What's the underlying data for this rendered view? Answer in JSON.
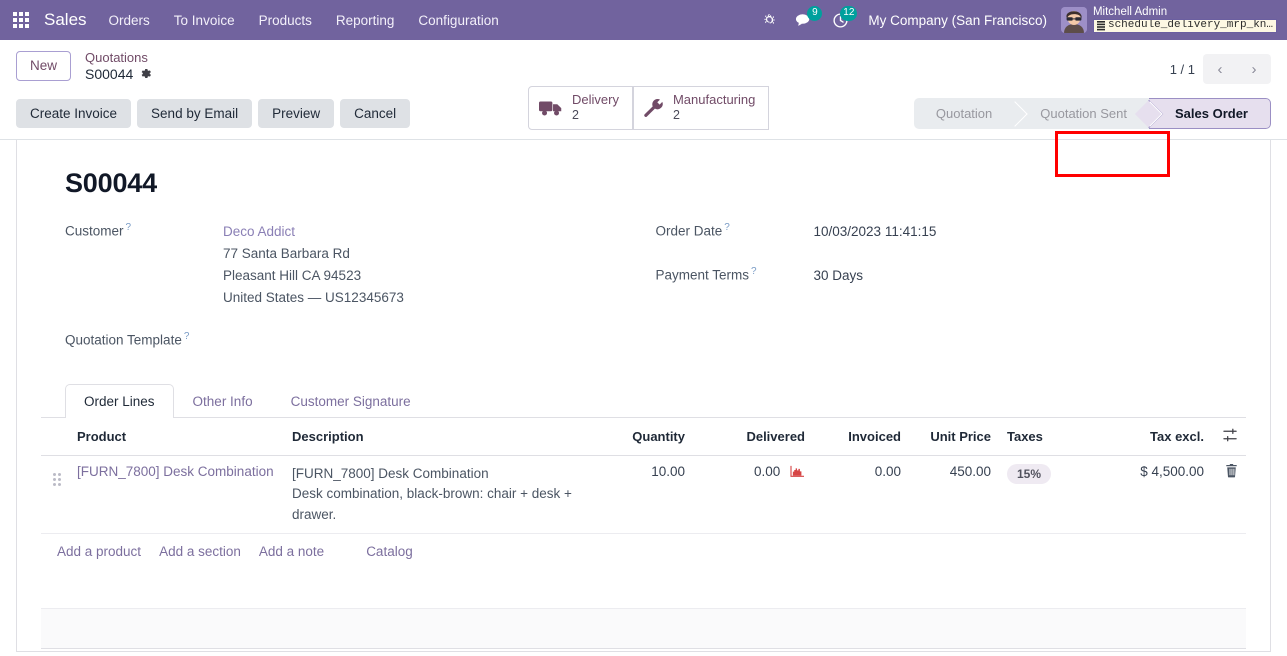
{
  "navbar": {
    "apps_icon": "apps-grid-icon",
    "brand": "Sales",
    "menu": [
      "Orders",
      "To Invoice",
      "Products",
      "Reporting",
      "Configuration"
    ],
    "systray": [
      {
        "icon": "bug-icon",
        "badge": ""
      },
      {
        "icon": "chat-bubble-icon",
        "badge": "9"
      },
      {
        "icon": "activity-clock-icon",
        "badge": "12"
      }
    ],
    "company": "My Company (San Francisco)",
    "user_name": "Mitchell Admin",
    "branch_chip": "schedule_delivery_mrp_kn…",
    "branch_icon": "database-icon"
  },
  "control_panel": {
    "new_button": "New",
    "breadcrumb_parent": "Quotations",
    "breadcrumb_current": "S00044",
    "gear_icon": "gear-icon",
    "smart_buttons": [
      {
        "icon": "truck-icon",
        "label": "Delivery",
        "value": "2",
        "highlighted": true
      },
      {
        "icon": "wrench-icon",
        "label": "Manufacturing",
        "value": "2",
        "highlighted": false
      }
    ],
    "pager_text": "1 / 1",
    "pager_prev_icon": "chevron-left-icon",
    "pager_next_icon": "chevron-right-icon",
    "action_buttons": [
      "Create Invoice",
      "Send by Email",
      "Preview",
      "Cancel"
    ],
    "status_steps": [
      {
        "label": "Quotation",
        "active": false
      },
      {
        "label": "Quotation Sent",
        "active": false
      },
      {
        "label": "Sales Order",
        "active": true
      }
    ]
  },
  "form": {
    "record_title": "S00044",
    "left_fields": [
      {
        "label": "Customer",
        "help": "?",
        "link_value": "Deco Addict",
        "address": [
          "77 Santa Barbara Rd",
          "Pleasant Hill CA 94523",
          "United States — US12345673"
        ]
      },
      {
        "label": "Quotation Template",
        "help": "?",
        "value": ""
      }
    ],
    "right_fields": [
      {
        "label": "Order Date",
        "help": "?",
        "value": "10/03/2023 11:41:15"
      },
      {
        "label": "Payment Terms",
        "help": "?",
        "value": "30 Days"
      }
    ]
  },
  "notebook": {
    "tabs": [
      {
        "label": "Order Lines",
        "active": true
      },
      {
        "label": "Other Info",
        "active": false
      },
      {
        "label": "Customer Signature",
        "active": false
      }
    ],
    "columns": [
      "Product",
      "Description",
      "Quantity",
      "Delivered",
      "Invoiced",
      "Unit Price",
      "Taxes",
      "Tax excl."
    ],
    "optional_columns_icon": "column-settings-icon",
    "rows": [
      {
        "drag_handle_icon": "drag-handle-icon",
        "product": "[FURN_7800] Desk Combination",
        "description_line1": "[FURN_7800] Desk Combination",
        "description_line2": "Desk combination, black-brown: chair + desk + drawer.",
        "quantity": "10.00",
        "delivered": "0.00",
        "delivered_icon": "forecast-report-icon",
        "invoiced": "0.00",
        "unit_price": "450.00",
        "taxes": "15%",
        "tax_excl": "$ 4,500.00",
        "delete_icon": "trash-icon"
      }
    ],
    "add_links": [
      "Add a product",
      "Add a section",
      "Add a note"
    ],
    "catalog_link": "Catalog"
  },
  "colors": {
    "brand_purple": "#714B67",
    "navbar_purple": "#71639e",
    "highlight_red": "#ff0000",
    "badge_green": "#00a09d",
    "forecast_red": "#d64545"
  }
}
